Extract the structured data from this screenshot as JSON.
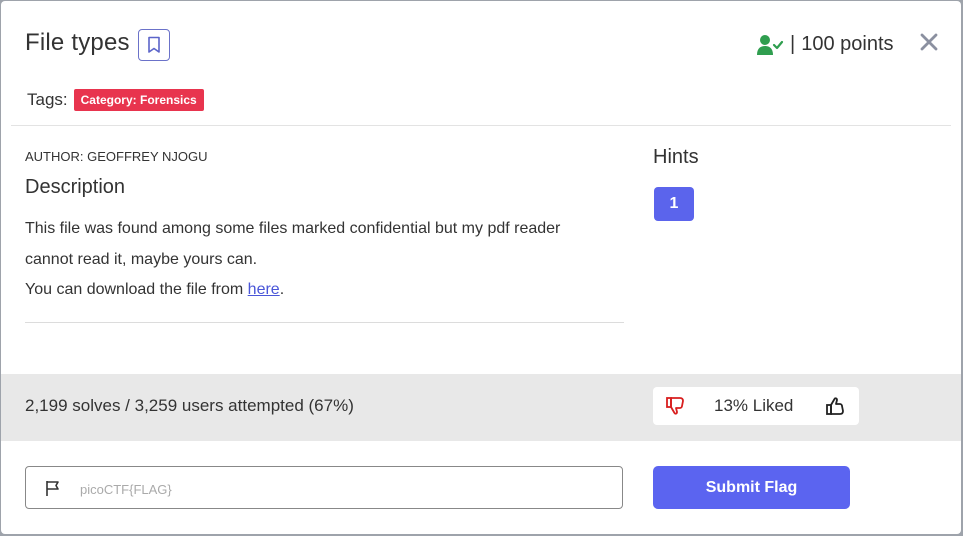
{
  "challenge": {
    "title": "File types",
    "points_separator": "|",
    "points_label": "100 points",
    "tags_label": "Tags:",
    "tags": [
      "Category: Forensics"
    ],
    "author": "AUTHOR: GEOFFREY NJOGU",
    "description_heading": "Description",
    "description_line1": "This file was found among some files marked confidential but my pdf reader",
    "description_line2": "cannot read it, maybe yours can.",
    "description_line3_prefix": "You can download the file from ",
    "description_link": "here",
    "description_line3_suffix": "."
  },
  "hints": {
    "heading": "Hints",
    "items": [
      "1"
    ]
  },
  "stats": {
    "solves_text": "2,199 solves / 3,259 users attempted (67%)",
    "liked_text": "13% Liked"
  },
  "flag_form": {
    "placeholder": "picoCTF{FLAG}",
    "submit_label": "Submit Flag"
  },
  "icons": {
    "bookmark": "bookmark-icon",
    "user_check": "user-check-icon",
    "close": "close-icon",
    "thumbs_down": "thumbs-down-icon",
    "thumbs_up": "thumbs-up-icon",
    "flag": "flag-icon"
  },
  "colors": {
    "accent": "#5b64f0",
    "tag_red": "#e8344e",
    "user_check_green": "#2f9e4f",
    "dislike_red": "#d81f1f"
  }
}
